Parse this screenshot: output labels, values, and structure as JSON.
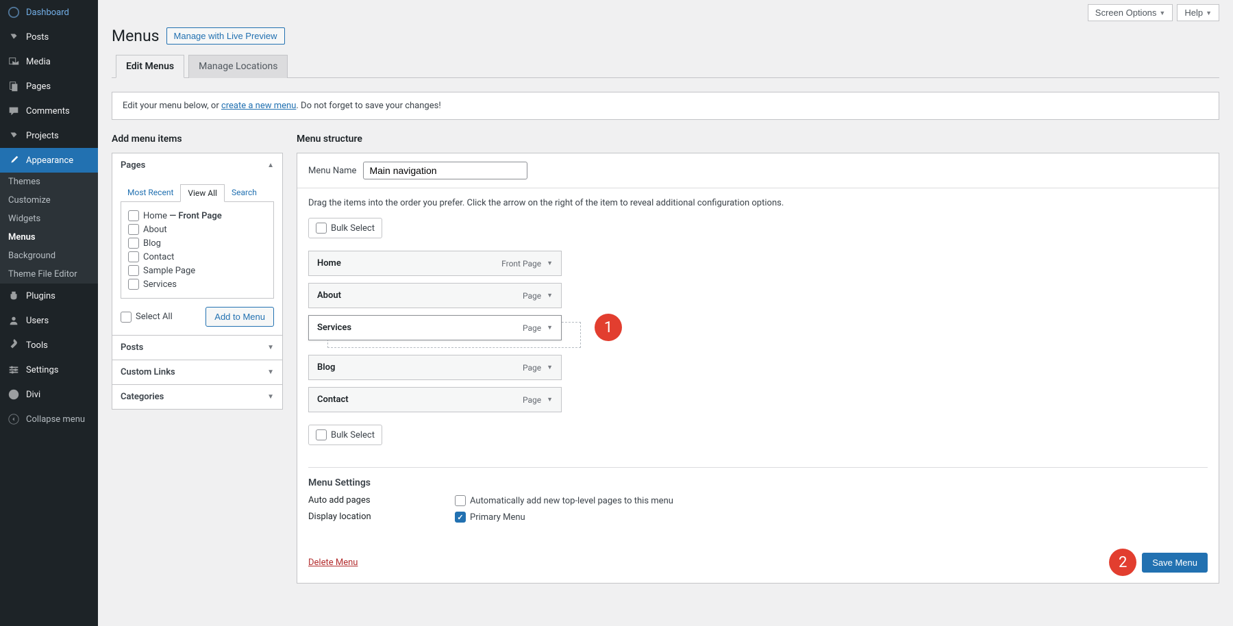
{
  "sidebar": {
    "items": [
      {
        "label": "Dashboard",
        "icon": "dashboard-icon"
      },
      {
        "label": "Posts",
        "icon": "pin-icon"
      },
      {
        "label": "Media",
        "icon": "media-icon"
      },
      {
        "label": "Pages",
        "icon": "pages-icon"
      },
      {
        "label": "Comments",
        "icon": "comments-icon"
      },
      {
        "label": "Projects",
        "icon": "projects-icon"
      },
      {
        "label": "Appearance",
        "icon": "brush-icon",
        "active": true
      },
      {
        "label": "Plugins",
        "icon": "plugin-icon"
      },
      {
        "label": "Users",
        "icon": "users-icon"
      },
      {
        "label": "Tools",
        "icon": "tools-icon"
      },
      {
        "label": "Settings",
        "icon": "settings-icon"
      },
      {
        "label": "Divi",
        "icon": "divi-icon"
      }
    ],
    "appearance_sub": [
      {
        "label": "Themes"
      },
      {
        "label": "Customize"
      },
      {
        "label": "Widgets"
      },
      {
        "label": "Menus",
        "current": true
      },
      {
        "label": "Background"
      },
      {
        "label": "Theme File Editor"
      }
    ],
    "collapse_label": "Collapse menu"
  },
  "top": {
    "screen_options": "Screen Options",
    "help": "Help"
  },
  "page": {
    "title": "Menus",
    "action_button": "Manage with Live Preview",
    "tabs": [
      {
        "label": "Edit Menus",
        "active": true
      },
      {
        "label": "Manage Locations"
      }
    ],
    "notice_prefix": "Edit your menu below, or ",
    "notice_link": "create a new menu",
    "notice_suffix": ". Do not forget to save your changes!"
  },
  "add_items": {
    "heading": "Add menu items",
    "panels": {
      "pages": {
        "title": "Pages",
        "tabs": [
          "Most Recent",
          "View All",
          "Search"
        ],
        "items": [
          {
            "label": "Home",
            "suffix": " — Front Page"
          },
          {
            "label": "About"
          },
          {
            "label": "Blog"
          },
          {
            "label": "Contact"
          },
          {
            "label": "Sample Page"
          },
          {
            "label": "Services"
          }
        ],
        "select_all": "Select All",
        "add_button": "Add to Menu"
      },
      "posts": {
        "title": "Posts"
      },
      "custom_links": {
        "title": "Custom Links"
      },
      "categories": {
        "title": "Categories"
      }
    }
  },
  "structure": {
    "heading": "Menu structure",
    "menu_name_label": "Menu Name",
    "menu_name_value": "Main navigation",
    "instructions": "Drag the items into the order you prefer. Click the arrow on the right of the item to reveal additional configuration options.",
    "bulk_select": "Bulk Select",
    "items": [
      {
        "title": "Home",
        "type": "Front Page"
      },
      {
        "title": "About",
        "type": "Page"
      },
      {
        "title": "Services",
        "type": "Page",
        "dragging": true
      },
      {
        "title": "Blog",
        "type": "Page"
      },
      {
        "title": "Contact",
        "type": "Page"
      }
    ],
    "settings": {
      "heading": "Menu Settings",
      "auto_add_label": "Auto add pages",
      "auto_add_option": "Automatically add new top-level pages to this menu",
      "display_label": "Display location",
      "primary_menu": "Primary Menu"
    },
    "delete_link": "Delete Menu",
    "save_button": "Save Menu"
  },
  "callouts": {
    "one": "1",
    "two": "2"
  }
}
